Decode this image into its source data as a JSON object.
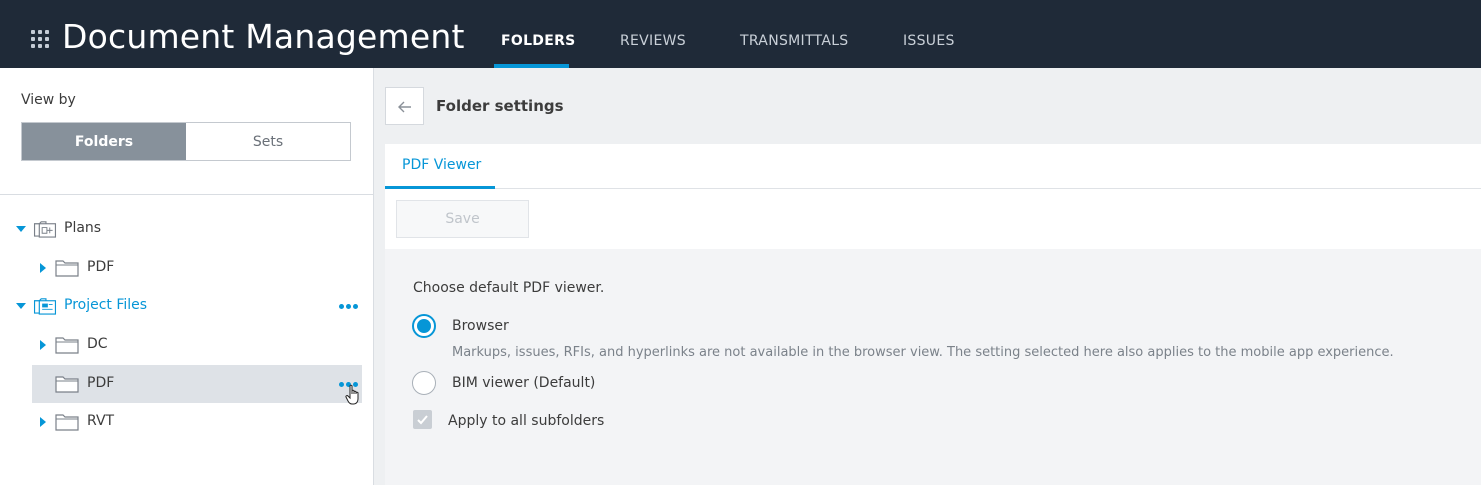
{
  "header": {
    "app_title": "Document Management",
    "tabs": [
      {
        "label": "FOLDERS",
        "active": true
      },
      {
        "label": "REVIEWS",
        "active": false
      },
      {
        "label": "TRANSMITTALS",
        "active": false
      },
      {
        "label": "ISSUES",
        "active": false
      }
    ],
    "accent_color": "#0696d7",
    "background_color": "#1f2a38"
  },
  "sidebar": {
    "view_by_label": "View by",
    "view_options": [
      {
        "label": "Folders",
        "active": true
      },
      {
        "label": "Sets",
        "active": false
      }
    ],
    "tree": [
      {
        "label": "Plans",
        "icon": "plans-icon",
        "expanded": true,
        "level": 0
      },
      {
        "label": "PDF",
        "icon": "folder-icon",
        "expanded": false,
        "level": 1
      },
      {
        "label": "Project Files",
        "icon": "project-files-icon",
        "expanded": true,
        "level": 0,
        "highlighted": true
      },
      {
        "label": "DC",
        "icon": "folder-icon",
        "expanded": false,
        "level": 1
      },
      {
        "label": "PDF",
        "icon": "folder-icon",
        "expanded": false,
        "level": 1,
        "selected": true
      },
      {
        "label": "RVT",
        "icon": "folder-icon",
        "expanded": false,
        "level": 1
      }
    ]
  },
  "main": {
    "title": "Folder settings",
    "tabs": [
      {
        "label": "PDF Viewer",
        "active": true
      }
    ],
    "save_label": "Save",
    "prompt": "Choose default PDF viewer.",
    "options": [
      {
        "label": "Browser",
        "selected": true,
        "description": "Markups, issues, RFIs, and hyperlinks are not available in the browser view. The setting selected here also applies to the mobile app experience."
      },
      {
        "label": "BIM viewer (Default)",
        "selected": false
      }
    ],
    "apply_all_label": "Apply to all subfolders",
    "apply_all_checked": true
  }
}
